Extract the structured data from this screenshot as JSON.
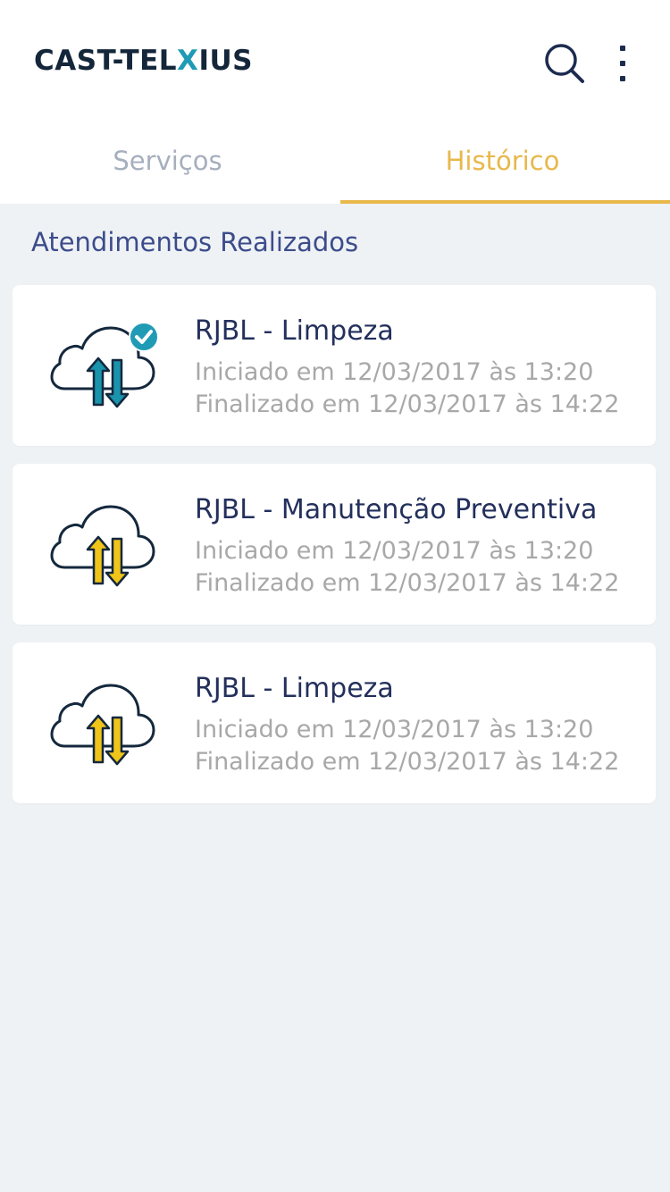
{
  "header": {
    "logo_part1": "CAST-TEL",
    "logo_x": "X",
    "logo_part2": "IUS",
    "search_icon": "search-icon",
    "menu_icon": "more-vertical-icon"
  },
  "tabs": [
    {
      "label": "Serviços",
      "active": false
    },
    {
      "label": "Histórico",
      "active": true
    }
  ],
  "colors": {
    "brand_dark": "#13263a",
    "brand_teal": "#1f9bb5",
    "accent_yellow": "#e8b84a",
    "title_blue": "#3c4c8b"
  },
  "section_title": "Atendimentos Realizados",
  "services": [
    {
      "title": "RJBL - Limpeza",
      "started": "Iniciado em 12/03/2017 às 13:20",
      "finished": "Finalizado em 12/03/2017 às 14:22",
      "icon": "cloud-transfer-check-icon",
      "variant": "teal-check"
    },
    {
      "title": "RJBL - Manutenção Preventiva",
      "started": "Iniciado em 12/03/2017 às 13:20",
      "finished": "Finalizado em 12/03/2017 às 14:22",
      "icon": "cloud-transfer-icon",
      "variant": "yellow"
    },
    {
      "title": "RJBL - Limpeza",
      "started": "Iniciado em 12/03/2017 às 13:20",
      "finished": "Finalizado em 12/03/2017 às 14:22",
      "icon": "cloud-transfer-icon",
      "variant": "yellow"
    }
  ]
}
